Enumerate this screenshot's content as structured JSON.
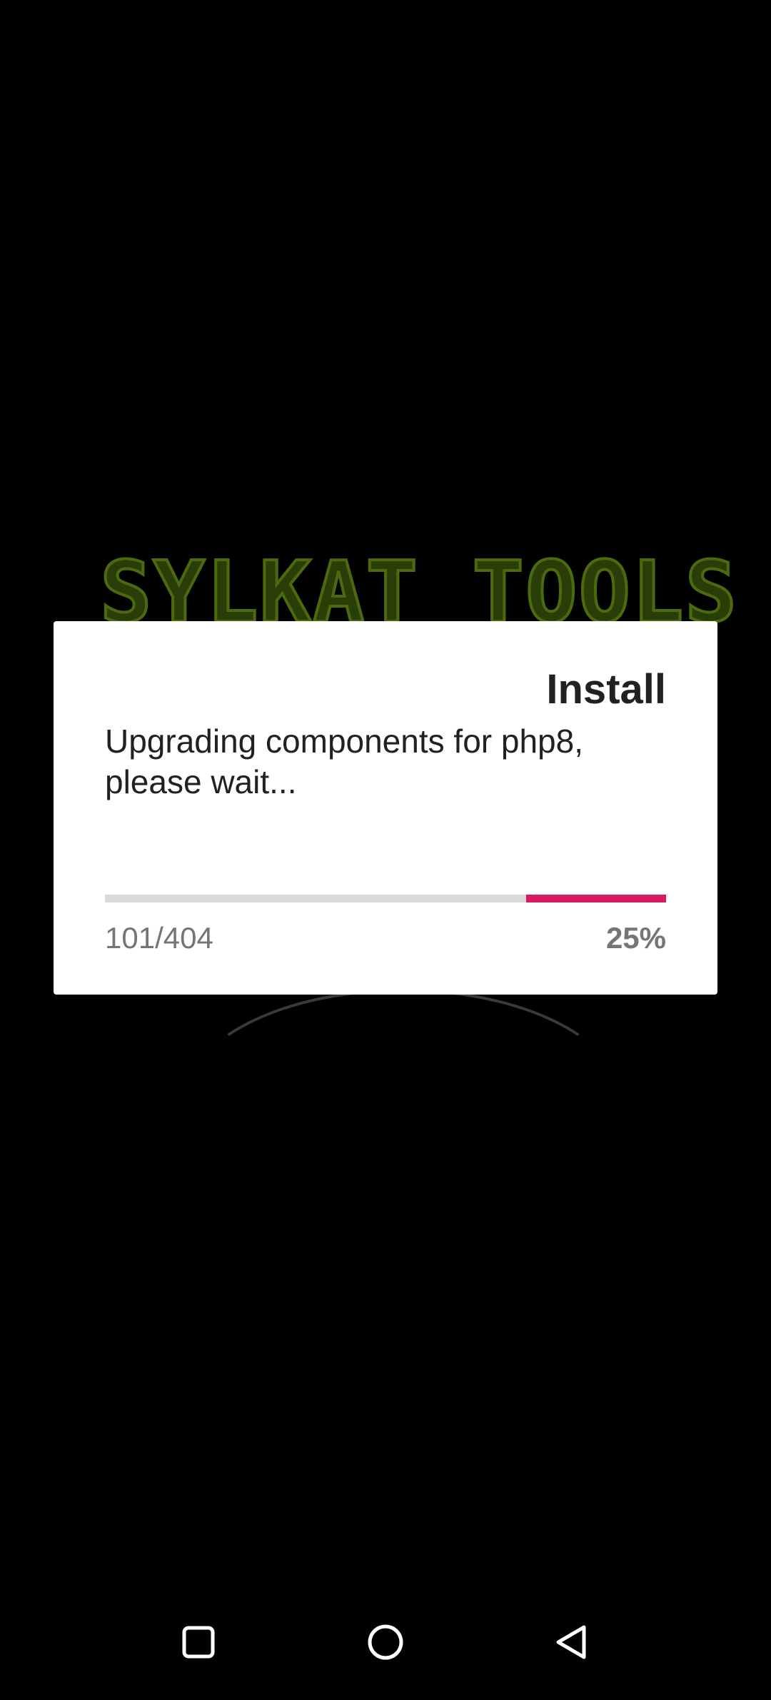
{
  "background": {
    "logo_text": "SYLKAT TOOLS",
    "logo_color": "#4b6a0e"
  },
  "dialog": {
    "title": "Install",
    "message": "Upgrading components for php8, please wait...",
    "progress": {
      "count_text": "101/404",
      "percent_text": "25%",
      "value": 0.25,
      "fill_color": "#d81b60",
      "track_color": "#d9d9d9"
    }
  },
  "navbar": {
    "buttons": [
      {
        "icon": "square-recents-icon"
      },
      {
        "icon": "circle-home-icon"
      },
      {
        "icon": "triangle-back-icon"
      }
    ]
  }
}
